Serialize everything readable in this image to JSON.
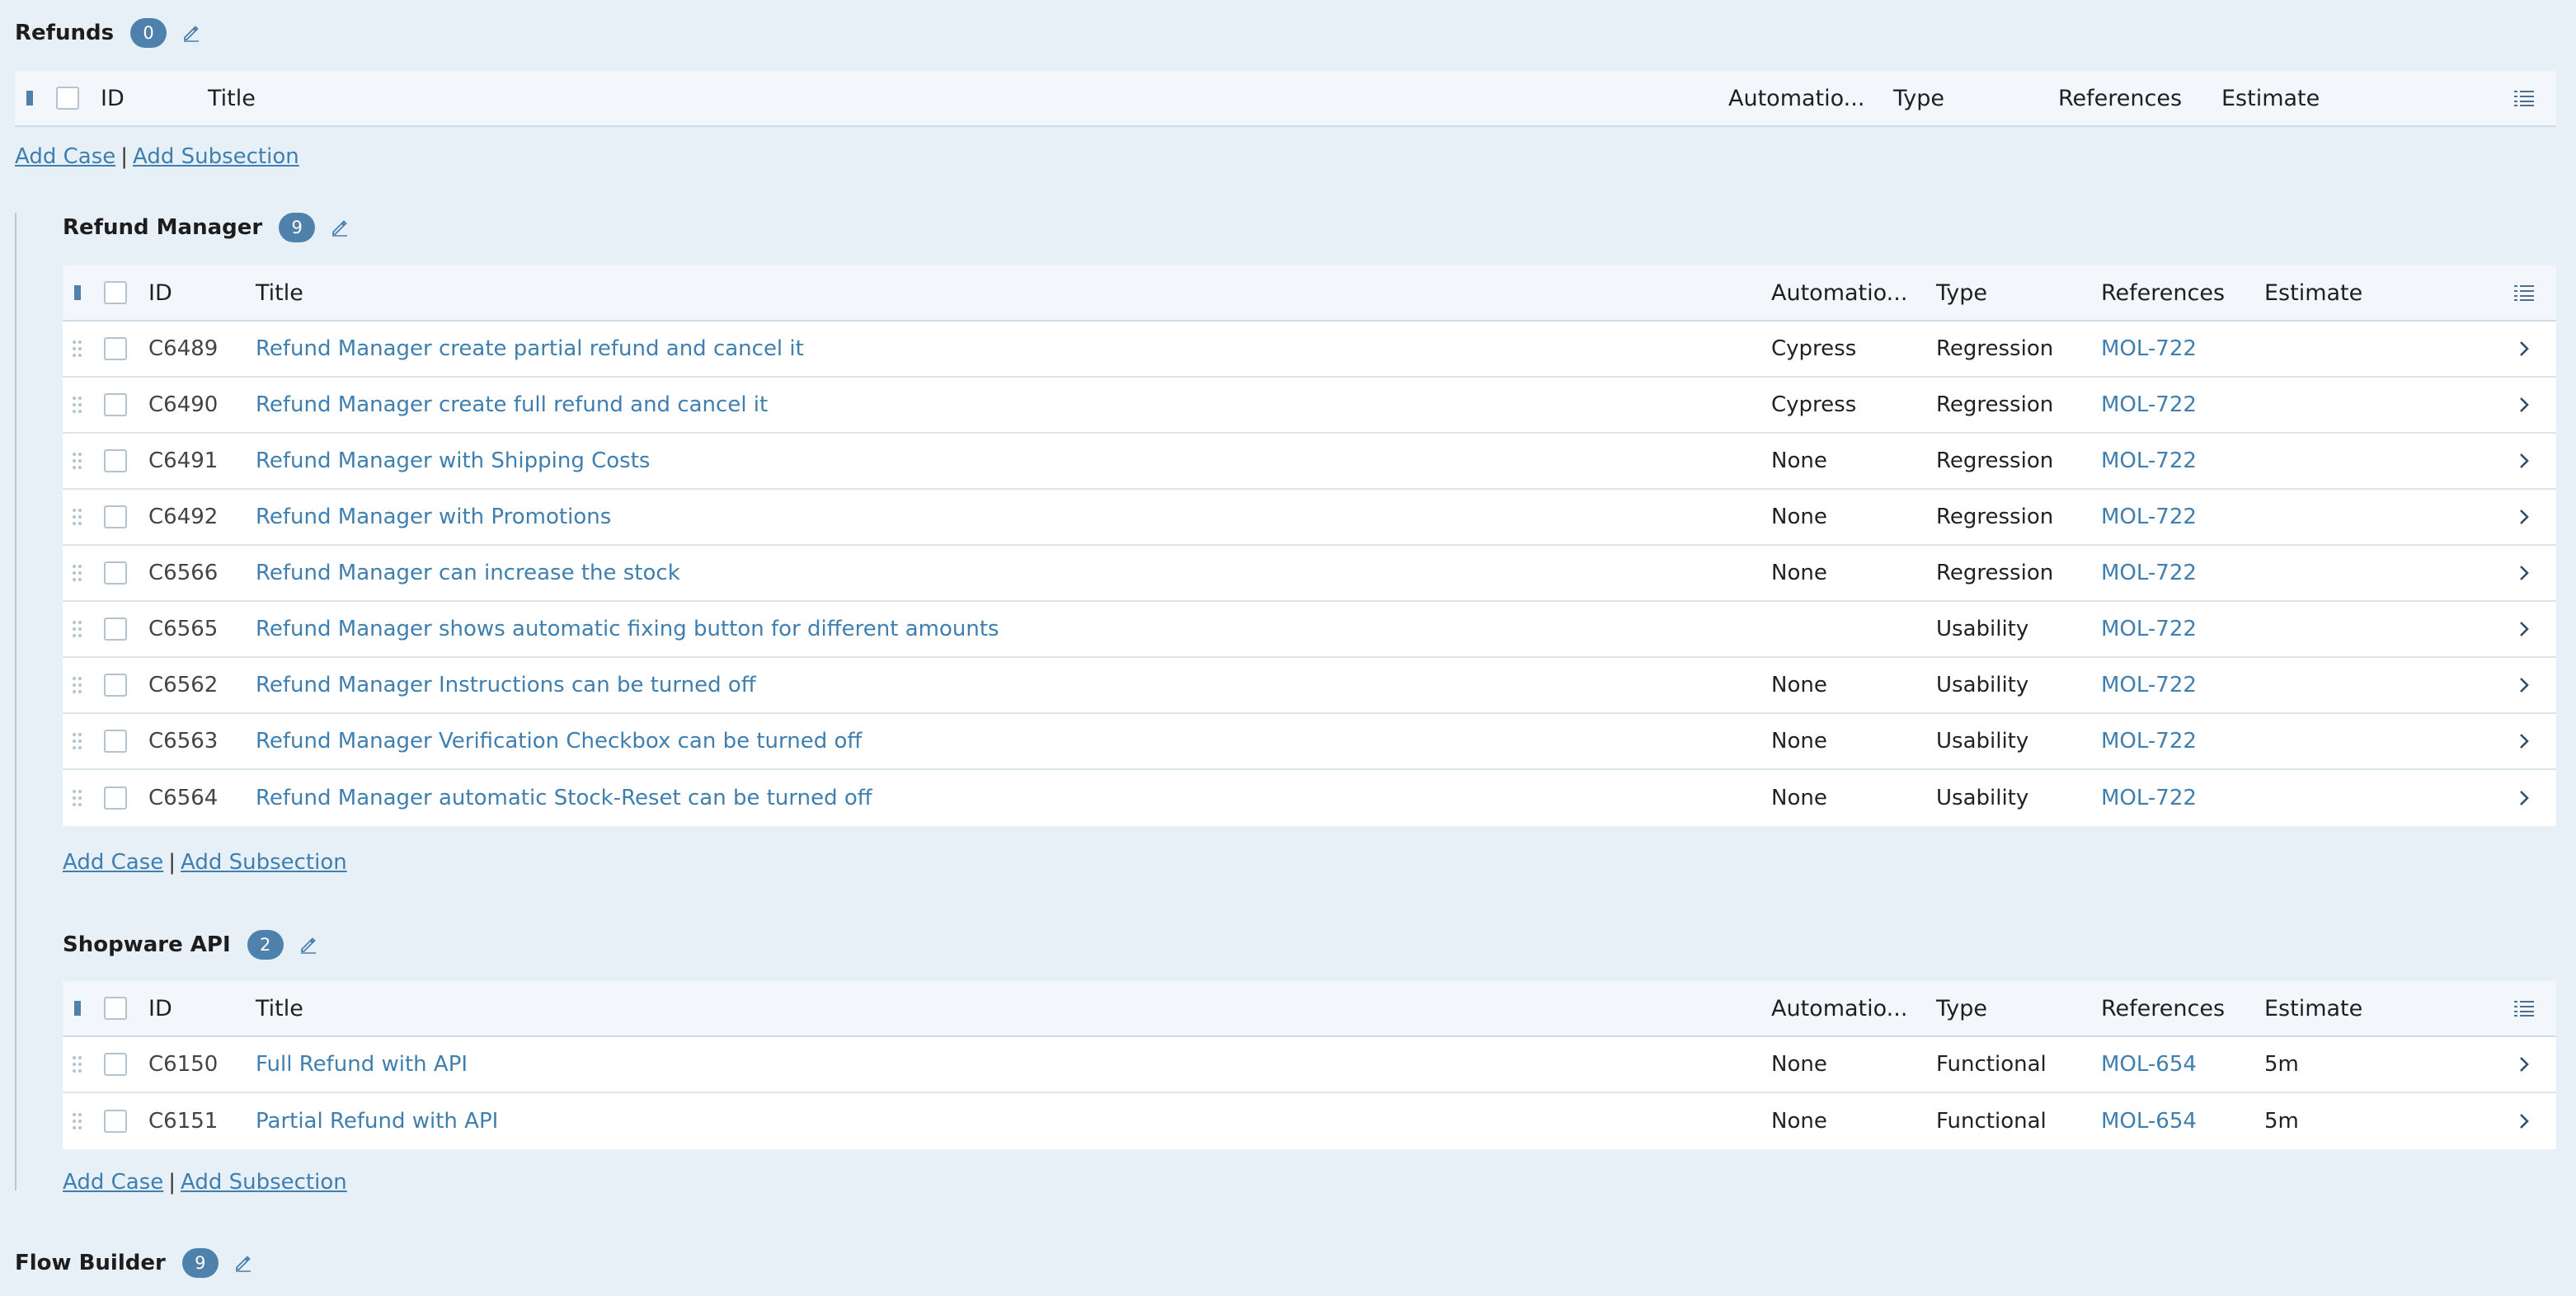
{
  "colors": {
    "background": "#e8f0f7",
    "badge": "#4f81ad",
    "link": "#3f7fb0"
  },
  "icons": {
    "edit": "pencil-icon",
    "drag": "drag-handle-icon",
    "row_detail": "chevron-right-icon",
    "column_options": "column-options-icon",
    "collapse": "collapse-bar-icon"
  },
  "columns": {
    "id": "ID",
    "title": "Title",
    "automation": "Automatio...",
    "type": "Type",
    "references": "References",
    "estimate": "Estimate"
  },
  "links": {
    "add_case": "Add Case",
    "separator": "|",
    "add_subsection": "Add Subsection"
  },
  "sections": {
    "refunds": {
      "title": "Refunds",
      "count": "0",
      "cases": []
    },
    "refund_manager": {
      "title": "Refund Manager",
      "count": "9",
      "cases": [
        {
          "id": "C6489",
          "title": "Refund Manager create partial refund and cancel it",
          "automation": "Cypress",
          "type": "Regression",
          "references": "MOL-722",
          "estimate": ""
        },
        {
          "id": "C6490",
          "title": "Refund Manager create full refund and cancel it",
          "automation": "Cypress",
          "type": "Regression",
          "references": "MOL-722",
          "estimate": ""
        },
        {
          "id": "C6491",
          "title": "Refund Manager with Shipping Costs",
          "automation": "None",
          "type": "Regression",
          "references": "MOL-722",
          "estimate": ""
        },
        {
          "id": "C6492",
          "title": "Refund Manager with Promotions",
          "automation": "None",
          "type": "Regression",
          "references": "MOL-722",
          "estimate": ""
        },
        {
          "id": "C6566",
          "title": "Refund Manager can increase the stock",
          "automation": "None",
          "type": "Regression",
          "references": "MOL-722",
          "estimate": ""
        },
        {
          "id": "C6565",
          "title": "Refund Manager shows automatic fixing button for different amounts",
          "automation": "",
          "type": "Usability",
          "references": "MOL-722",
          "estimate": ""
        },
        {
          "id": "C6562",
          "title": "Refund Manager Instructions can be turned off",
          "automation": "None",
          "type": "Usability",
          "references": "MOL-722",
          "estimate": ""
        },
        {
          "id": "C6563",
          "title": "Refund Manager Verification Checkbox can be turned off",
          "automation": "None",
          "type": "Usability",
          "references": "MOL-722",
          "estimate": ""
        },
        {
          "id": "C6564",
          "title": "Refund Manager automatic Stock-Reset can be turned off",
          "automation": "None",
          "type": "Usability",
          "references": "MOL-722",
          "estimate": ""
        }
      ]
    },
    "shopware_api": {
      "title": "Shopware API",
      "count": "2",
      "cases": [
        {
          "id": "C6150",
          "title": "Full Refund with API",
          "automation": "None",
          "type": "Functional",
          "references": "MOL-654",
          "estimate": "5m"
        },
        {
          "id": "C6151",
          "title": "Partial Refund with API",
          "automation": "None",
          "type": "Functional",
          "references": "MOL-654",
          "estimate": "5m"
        }
      ]
    },
    "flow_builder": {
      "title": "Flow Builder",
      "count": "9"
    }
  }
}
